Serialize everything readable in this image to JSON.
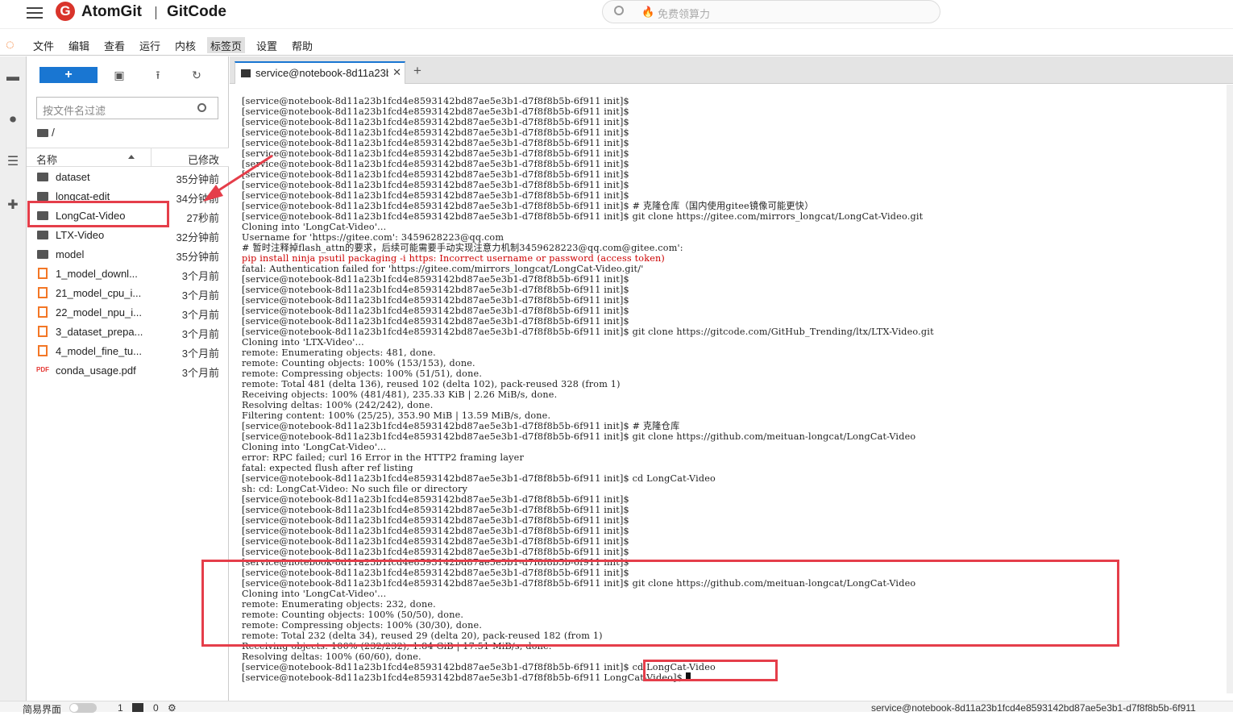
{
  "header": {
    "brand": "AtomGit",
    "product": "GitCode",
    "search_placeholder": "免费领算力"
  },
  "menubar": {
    "items": [
      "文件",
      "编辑",
      "查看",
      "运行",
      "内核",
      "标签页",
      "设置",
      "帮助"
    ],
    "active": "标签页"
  },
  "filebrowser": {
    "new_label": "+",
    "filter_placeholder": "按文件名过滤",
    "breadcrumb": "/",
    "col_name": "名称",
    "col_modified": "已修改",
    "files": [
      {
        "name": "dataset",
        "type": "folder",
        "modified": "35分钟前"
      },
      {
        "name": "longcat-edit",
        "type": "folder",
        "modified": "34分钟前"
      },
      {
        "name": "LongCat-Video",
        "type": "folder",
        "modified": "27秒前"
      },
      {
        "name": "LTX-Video",
        "type": "folder",
        "modified": "32分钟前"
      },
      {
        "name": "model",
        "type": "folder",
        "modified": "35分钟前"
      },
      {
        "name": "1_model_downl...",
        "type": "notebook",
        "modified": "3个月前"
      },
      {
        "name": "21_model_cpu_i...",
        "type": "notebook",
        "modified": "3个月前"
      },
      {
        "name": "22_model_npu_i...",
        "type": "notebook",
        "modified": "3个月前"
      },
      {
        "name": "3_dataset_prepa...",
        "type": "notebook",
        "modified": "3个月前"
      },
      {
        "name": "4_model_fine_tu...",
        "type": "notebook",
        "modified": "3个月前"
      },
      {
        "name": "conda_usage.pdf",
        "type": "pdf",
        "modified": "3个月前"
      }
    ]
  },
  "terminal": {
    "tab_label": "service@notebook-8d11a23b",
    "prompt": "[service@notebook-8d11a23b1fcd4e8593142bd87ae5e3b1-d7f8f8b5b-6f911 init]$",
    "prompt_final": "[service@notebook-8d11a23b1fcd4e8593142bd87ae5e3b1-d7f8f8b5b-6f911 LongCat-Video]$",
    "lines": [
      {
        "t": "[service@notebook-8d11a23b1fcd4e8593142bd87ae5e3b1-d7f8f8b5b-6f911 init]$"
      },
      {
        "t": "[service@notebook-8d11a23b1fcd4e8593142bd87ae5e3b1-d7f8f8b5b-6f911 init]$"
      },
      {
        "t": "[service@notebook-8d11a23b1fcd4e8593142bd87ae5e3b1-d7f8f8b5b-6f911 init]$"
      },
      {
        "t": "[service@notebook-8d11a23b1fcd4e8593142bd87ae5e3b1-d7f8f8b5b-6f911 init]$"
      },
      {
        "t": "[service@notebook-8d11a23b1fcd4e8593142bd87ae5e3b1-d7f8f8b5b-6f911 init]$"
      },
      {
        "t": "[service@notebook-8d11a23b1fcd4e8593142bd87ae5e3b1-d7f8f8b5b-6f911 init]$"
      },
      {
        "t": "[service@notebook-8d11a23b1fcd4e8593142bd87ae5e3b1-d7f8f8b5b-6f911 init]$"
      },
      {
        "t": "[service@notebook-8d11a23b1fcd4e8593142bd87ae5e3b1-d7f8f8b5b-6f911 init]$"
      },
      {
        "t": "[service@notebook-8d11a23b1fcd4e8593142bd87ae5e3b1-d7f8f8b5b-6f911 init]$"
      },
      {
        "t": "[service@notebook-8d11a23b1fcd4e8593142bd87ae5e3b1-d7f8f8b5b-6f911 init]$"
      },
      {
        "t": "[service@notebook-8d11a23b1fcd4e8593142bd87ae5e3b1-d7f8f8b5b-6f911 init]$ # 克隆仓库（国内使用gitee镜像可能更快）"
      },
      {
        "t": "[service@notebook-8d11a23b1fcd4e8593142bd87ae5e3b1-d7f8f8b5b-6f911 init]$ git clone https://gitee.com/mirrors_longcat/LongCat-Video.git"
      },
      {
        "t": "Cloning into 'LongCat-Video'..."
      },
      {
        "t": "Username for 'https://gitee.com': 3459628223@qq.com"
      },
      {
        "t": "# 暂时注释掉flash_attn的要求，后续可能需要手动实现注意力机制3459628223@qq.com@gitee.com':"
      },
      {
        "t": "pip install ninja psutil packaging -i https: Incorrect username or password (access token)",
        "err": true
      },
      {
        "t": "fatal: Authentication failed for 'https://gitee.com/mirrors_longcat/LongCat-Video.git/'"
      },
      {
        "t": "[service@notebook-8d11a23b1fcd4e8593142bd87ae5e3b1-d7f8f8b5b-6f911 init]$"
      },
      {
        "t": "[service@notebook-8d11a23b1fcd4e8593142bd87ae5e3b1-d7f8f8b5b-6f911 init]$"
      },
      {
        "t": "[service@notebook-8d11a23b1fcd4e8593142bd87ae5e3b1-d7f8f8b5b-6f911 init]$"
      },
      {
        "t": "[service@notebook-8d11a23b1fcd4e8593142bd87ae5e3b1-d7f8f8b5b-6f911 init]$"
      },
      {
        "t": "[service@notebook-8d11a23b1fcd4e8593142bd87ae5e3b1-d7f8f8b5b-6f911 init]$"
      },
      {
        "t": "[service@notebook-8d11a23b1fcd4e8593142bd87ae5e3b1-d7f8f8b5b-6f911 init]$ git clone https://gitcode.com/GitHub_Trending/ltx/LTX-Video.git"
      },
      {
        "t": "Cloning into 'LTX-Video'..."
      },
      {
        "t": "remote: Enumerating objects: 481, done."
      },
      {
        "t": "remote: Counting objects: 100% (153/153), done."
      },
      {
        "t": "remote: Compressing objects: 100% (51/51), done."
      },
      {
        "t": "remote: Total 481 (delta 136), reused 102 (delta 102), pack-reused 328 (from 1)"
      },
      {
        "t": "Receiving objects: 100% (481/481), 235.33 KiB | 2.26 MiB/s, done."
      },
      {
        "t": "Resolving deltas: 100% (242/242), done."
      },
      {
        "t": "Filtering content: 100% (25/25), 353.90 MiB | 13.59 MiB/s, done."
      },
      {
        "t": "[service@notebook-8d11a23b1fcd4e8593142bd87ae5e3b1-d7f8f8b5b-6f911 init]$ # 克隆仓库"
      },
      {
        "t": "[service@notebook-8d11a23b1fcd4e8593142bd87ae5e3b1-d7f8f8b5b-6f911 init]$ git clone https://github.com/meituan-longcat/LongCat-Video"
      },
      {
        "t": "Cloning into 'LongCat-Video'..."
      },
      {
        "t": "error: RPC failed; curl 16 Error in the HTTP2 framing layer"
      },
      {
        "t": "fatal: expected flush after ref listing"
      },
      {
        "t": "[service@notebook-8d11a23b1fcd4e8593142bd87ae5e3b1-d7f8f8b5b-6f911 init]$ cd LongCat-Video"
      },
      {
        "t": "sh: cd: LongCat-Video: No such file or directory"
      },
      {
        "t": "[service@notebook-8d11a23b1fcd4e8593142bd87ae5e3b1-d7f8f8b5b-6f911 init]$"
      },
      {
        "t": "[service@notebook-8d11a23b1fcd4e8593142bd87ae5e3b1-d7f8f8b5b-6f911 init]$"
      },
      {
        "t": "[service@notebook-8d11a23b1fcd4e8593142bd87ae5e3b1-d7f8f8b5b-6f911 init]$"
      },
      {
        "t": "[service@notebook-8d11a23b1fcd4e8593142bd87ae5e3b1-d7f8f8b5b-6f911 init]$"
      },
      {
        "t": "[service@notebook-8d11a23b1fcd4e8593142bd87ae5e3b1-d7f8f8b5b-6f911 init]$"
      },
      {
        "t": "[service@notebook-8d11a23b1fcd4e8593142bd87ae5e3b1-d7f8f8b5b-6f911 init]$"
      },
      {
        "t": "[service@notebook-8d11a23b1fcd4e8593142bd87ae5e3b1-d7f8f8b5b-6f911 init]$"
      },
      {
        "t": "[service@notebook-8d11a23b1fcd4e8593142bd87ae5e3b1-d7f8f8b5b-6f911 init]$"
      },
      {
        "t": "[service@notebook-8d11a23b1fcd4e8593142bd87ae5e3b1-d7f8f8b5b-6f911 init]$ git clone https://github.com/meituan-longcat/LongCat-Video"
      },
      {
        "t": "Cloning into 'LongCat-Video'..."
      },
      {
        "t": "remote: Enumerating objects: 232, done."
      },
      {
        "t": "remote: Counting objects: 100% (50/50), done."
      },
      {
        "t": "remote: Compressing objects: 100% (30/30), done."
      },
      {
        "t": "remote: Total 232 (delta 34), reused 29 (delta 20), pack-reused 182 (from 1)"
      },
      {
        "t": "Receiving objects: 100% (232/232), 1.84 GiB | 17.51 MiB/s, done."
      },
      {
        "t": "Resolving deltas: 100% (60/60), done."
      },
      {
        "t": "[service@notebook-8d11a23b1fcd4e8593142bd87ae5e3b1-d7f8f8b5b-6f911 init]$ cd LongCat-Video"
      },
      {
        "t": "[service@notebook-8d11a23b1fcd4e8593142bd87ae5e3b1-d7f8f8b5b-6f911 LongCat-Video]$",
        "cursor": true
      }
    ]
  },
  "statusbar": {
    "simple_mode": "简易界面",
    "count1": "1",
    "count2": "0",
    "right_text": "service@notebook-8d11a23b1fcd4e8593142bd87ae5e3b1-d7f8f8b5b-6f911"
  },
  "colors": {
    "accent": "#1976d2",
    "jupyter_orange": "#f37726",
    "annotation_red": "#e53e4a",
    "error_red": "#cc0000"
  }
}
